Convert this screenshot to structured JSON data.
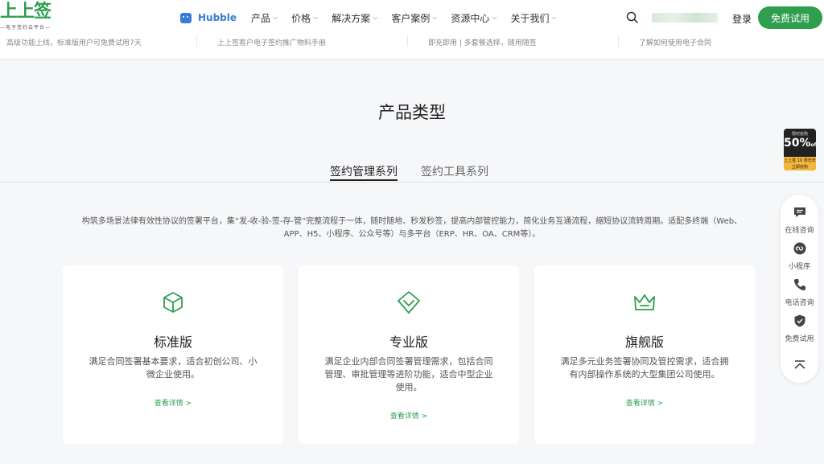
{
  "brand": {
    "logo_text": "上上签",
    "logo_sub": "—电子签约云平台—"
  },
  "nav": {
    "hubble": "Hubble",
    "items": [
      {
        "label": "产品"
      },
      {
        "label": "价格"
      },
      {
        "label": "解决方案"
      },
      {
        "label": "客户案例"
      },
      {
        "label": "资源中心"
      },
      {
        "label": "关于我们"
      }
    ],
    "chevron": "⌵"
  },
  "header": {
    "login": "登录",
    "trial": "免费试用"
  },
  "strip": [
    "高级功能上线，标准版用户可免费试用7天",
    "上上签客户电子签约推广物料手册",
    "即充即用 | 多套餐选择，随用随签",
    "了解如何使用电子合同"
  ],
  "main": {
    "title": "产品类型",
    "tabs": [
      {
        "label": "签约管理系列"
      },
      {
        "label": "签约工具系列"
      }
    ],
    "intro": "构筑多场景法律有效性协议的签署平台，集“发-收-验-签-存-管”完整流程于一体，随时随地、秒发秒签，提高内部管控能力，简化业务互通流程，缩短协议流转周期。适配多终端（Web、APP、H5、小程序、公众号等）与多平台（ERP、HR、OA、CRM等）。",
    "cards": [
      {
        "title": "标准版",
        "desc": "满足合同签署基本要求，适合初创公司、小微企业使用。",
        "more": "查看详情 >",
        "icon": "box-icon"
      },
      {
        "title": "专业版",
        "desc": "满足企业内部合同签署管理需求，包括合同管理、审批管理等进阶功能，适合中型企业使用。",
        "more": "查看详情 >",
        "icon": "shield-check-icon"
      },
      {
        "title": "旗舰版",
        "desc": "满足多元业务签署协同及管控需求，适合拥有内部操作系统的大型集团公司使用。",
        "more": "查看详情 >",
        "icon": "crown-icon"
      }
    ]
  },
  "promo": {
    "top": "限时抢购",
    "value": "50%",
    "off": "off",
    "bottom1": "上上签 10 周年庆",
    "bottom2": "立即抢购"
  },
  "side": [
    {
      "label": "在线咨询",
      "icon": "chat-icon"
    },
    {
      "label": "小程序",
      "icon": "mini-program-icon"
    },
    {
      "label": "电话咨询",
      "icon": "phone-icon"
    },
    {
      "label": "免费试用",
      "icon": "trial-badge-icon"
    },
    {
      "label": "",
      "icon": "back-to-top-icon"
    }
  ],
  "colors": {
    "brand": "#2e9e4f",
    "hubble": "#3a7bd5",
    "promo": "#f3b63a"
  }
}
